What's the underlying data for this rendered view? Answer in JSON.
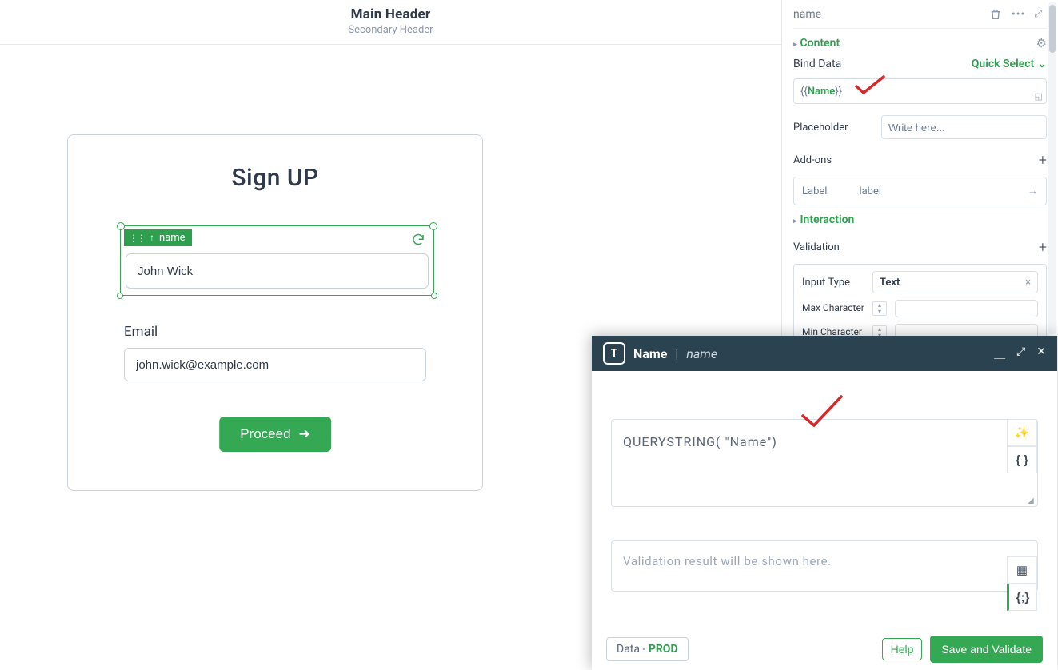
{
  "header": {
    "main": "Main Header",
    "secondary": "Secondary Header"
  },
  "canvas": {
    "title": "Sign UP",
    "selected_control_tag": "name",
    "name_value": "John Wick",
    "email_label": "Email",
    "email_value": "john.wick@example.com",
    "proceed_label": "Proceed"
  },
  "props": {
    "component_name": "name",
    "sections": {
      "content": {
        "title": "Content",
        "bind_data_label": "Bind Data",
        "quick_select": "Quick Select",
        "bind_expression_open": "{{",
        "bind_expression_var": "Name",
        "bind_expression_close": "}}",
        "placeholder_label": "Placeholder",
        "placeholder_value": "Write here...",
        "addons_label": "Add-ons",
        "addon_label_key": "Label",
        "addon_label_value": "label"
      },
      "interaction": {
        "title": "Interaction",
        "validation_label": "Validation",
        "input_type_label": "Input Type",
        "input_type_value": "Text",
        "max_char_label": "Max Character",
        "min_char_label": "Min Character"
      }
    }
  },
  "formula": {
    "title_name": "Name",
    "title_sub": "name",
    "code": "QUERYSTRING( \"Name\")",
    "result_placeholder": "Validation result will be shown here.",
    "data_label": "Data - ",
    "data_env": "PROD",
    "help_label": "Help",
    "save_label": "Save and Validate"
  }
}
